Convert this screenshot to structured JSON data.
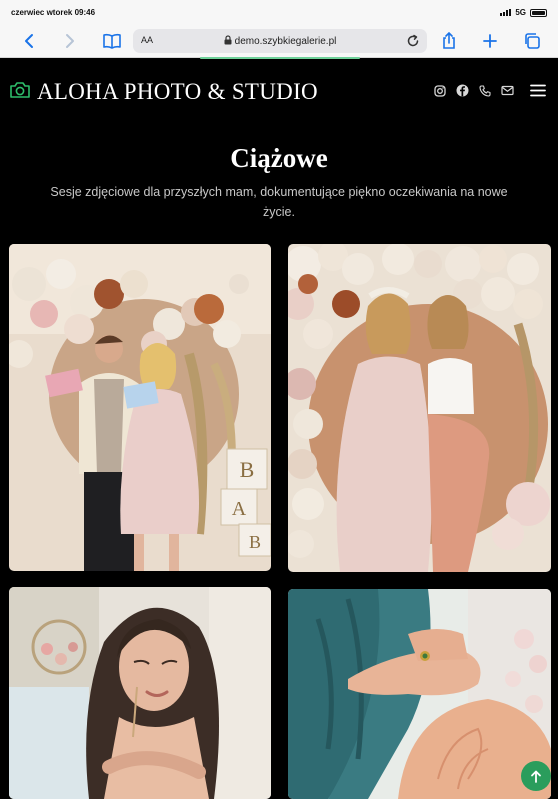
{
  "status_bar": {
    "time": "czerwiec wtorek 09:46",
    "network": "5G"
  },
  "browser": {
    "aa_label": "AA",
    "url": "demo.szybkiegalerie.pl"
  },
  "site": {
    "brand": "ALOHA PHOTO & STUDIO",
    "accent_color": "#2ebd6b"
  },
  "hero": {
    "title": "Ciążowe",
    "subtitle": "Sesje zdjęciowe dla przyszłych mam, dokumentujące piękno oczekiwania na nowe życie."
  },
  "gallery": {
    "photos": [
      {
        "name": "couple-balloons-photo"
      },
      {
        "name": "two-women-balloons-photo"
      },
      {
        "name": "woman-portrait-photo"
      },
      {
        "name": "belly-closeup-photo"
      }
    ]
  },
  "icons": {
    "social": [
      "instagram-icon",
      "facebook-icon",
      "phone-icon",
      "mail-icon"
    ],
    "menu": "hamburger-menu-icon",
    "back_to_top": "arrow-up-icon"
  }
}
